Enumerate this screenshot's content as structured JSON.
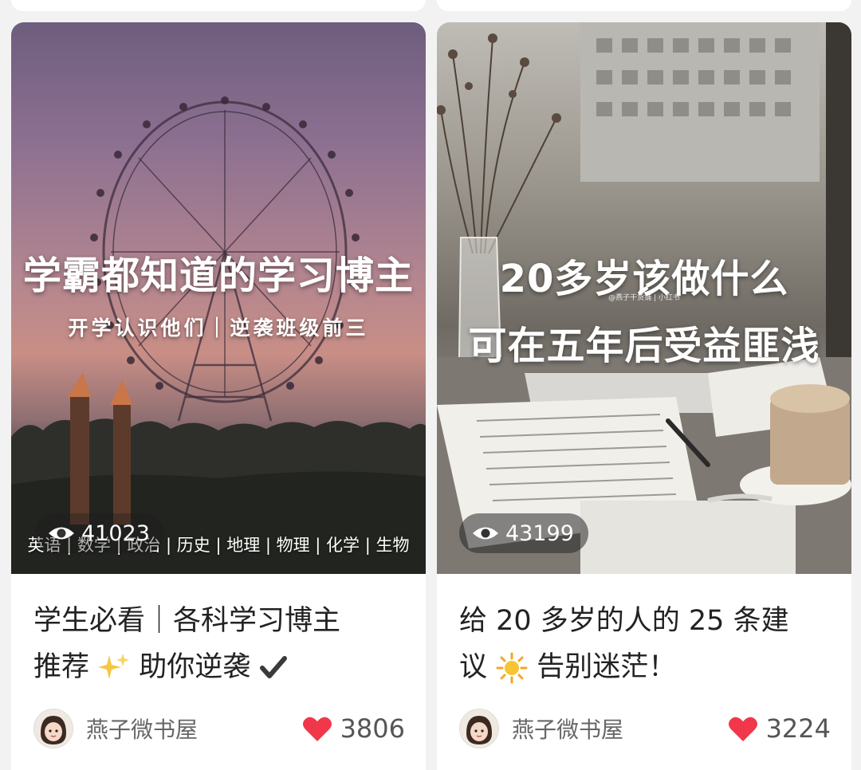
{
  "feed": {
    "cards": [
      {
        "cover_title": "学霸都知道的学习博主",
        "cover_subtitle": "开学认识他们｜逆袭班级前三",
        "cover_subjects": "英语 | 数学 | 政治 | 历史 | 地理 | 物理 | 化学 | 生物",
        "views": "41023",
        "title_line1": "学生必看｜各科学习博主",
        "title_line2_a": "推荐",
        "title_line2_b": "助你逆袭",
        "author": "燕子微书屋",
        "likes": "3806"
      },
      {
        "cover_title_1": "20多岁该做什么",
        "cover_watermark": "@燕子干货铺 | 小红书",
        "cover_title_2": "可在五年后受益匪浅",
        "views": "43199",
        "title_line1": "给 20 多岁的人的 25 条建",
        "title_line2_a": "议",
        "title_line2_b": "告别迷茫！",
        "author": "燕子微书屋",
        "likes": "3224"
      }
    ]
  },
  "icons": {
    "eye": "eye-icon",
    "heart": "heart-icon",
    "sparkles": "sparkles-icon",
    "checkmark": "checkmark-icon",
    "sun": "sun-icon"
  },
  "colors": {
    "heart": "#f0384a",
    "title_text": "#222222",
    "author_text": "#666666"
  }
}
